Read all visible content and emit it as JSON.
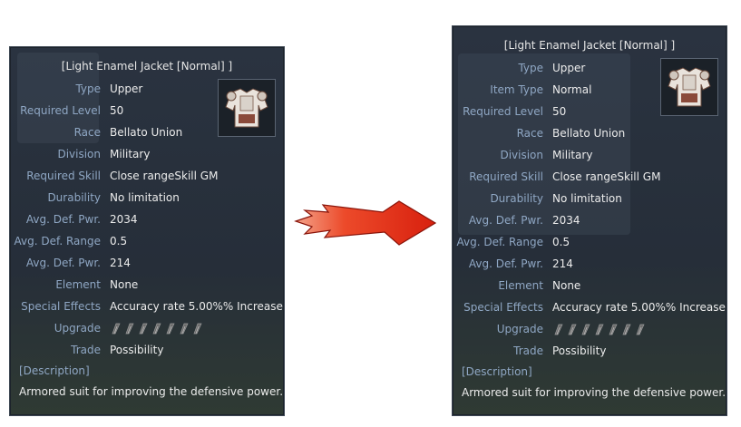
{
  "left_panel": {
    "title": "[Light Enamel Jacket [Normal] ]",
    "rows": [
      {
        "label": "Type",
        "value": "Upper"
      },
      {
        "label": "Required Level",
        "value": "50"
      },
      {
        "label": "Race",
        "value": "Bellato Union"
      },
      {
        "label": "Division",
        "value": "Military"
      },
      {
        "label": "Required Skill",
        "value": "Close rangeSkill GM"
      },
      {
        "label": "Durability",
        "value": "No limitation"
      },
      {
        "label": "Avg. Def. Pwr.",
        "value": "2034"
      },
      {
        "label": "Avg. Def. Range",
        "value": "0.5"
      },
      {
        "label": "Avg. Def. Pwr.",
        "value": "214"
      },
      {
        "label": "Element",
        "value": "None"
      },
      {
        "label": "Special Effects",
        "value": "Accuracy rate 5.00%% Increase"
      },
      {
        "label": "Upgrade",
        "value": ""
      },
      {
        "label": "Trade",
        "value": "Possibility"
      }
    ],
    "description_label": "[Description]",
    "description_text": "Armored suit for improving the defensive power."
  },
  "right_panel": {
    "title": "[Light Enamel Jacket [Normal] ]",
    "rows": [
      {
        "label": "Type",
        "value": "Upper"
      },
      {
        "label": "Item Type",
        "value": "Normal"
      },
      {
        "label": "Required Level",
        "value": "50"
      },
      {
        "label": "Race",
        "value": "Bellato Union"
      },
      {
        "label": "Division",
        "value": "Military"
      },
      {
        "label": "Required Skill",
        "value": "Close rangeSkill GM"
      },
      {
        "label": "Durability",
        "value": "No limitation"
      },
      {
        "label": "Avg. Def. Pwr.",
        "value": "2034"
      },
      {
        "label": "Avg. Def. Range",
        "value": "0.5"
      },
      {
        "label": "Avg. Def. Pwr.",
        "value": "214"
      },
      {
        "label": "Element",
        "value": "None"
      },
      {
        "label": "Special Effects",
        "value": "Accuracy rate 5.00%% Increase"
      },
      {
        "label": "Upgrade",
        "value": ""
      },
      {
        "label": "Trade",
        "value": "Possibility"
      }
    ],
    "description_label": "[Description]",
    "description_text": "Armored suit for improving the defensive power."
  },
  "upgrade_slot_count": 7,
  "icons": {
    "item_thumbnail": "armor-jacket-icon",
    "upgrade_slot": "talic-slot-icon",
    "transition": "red-arrow-icon"
  },
  "colors": {
    "label": "#8fa7c4",
    "value": "#ececec",
    "arrow": "#e8321c"
  }
}
